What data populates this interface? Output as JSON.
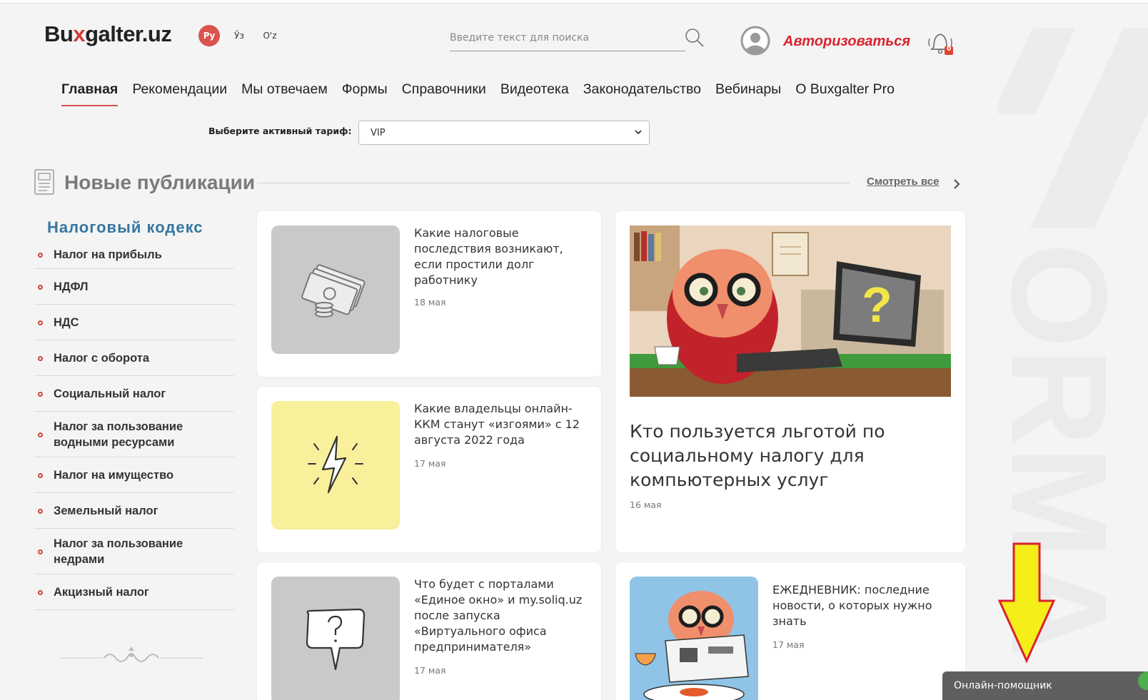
{
  "header": {
    "logo_text": "Bu",
    "logo_x": "x",
    "logo_rest": "galter.uz",
    "languages": [
      {
        "label": "Ру",
        "active": true
      },
      {
        "label": "Ўз",
        "active": false
      },
      {
        "label": "O'z",
        "active": false
      }
    ],
    "search_placeholder": "Введите текст для поиска",
    "login_label": "Авторизоваться",
    "notification_count": "0"
  },
  "nav": {
    "items": [
      {
        "label": "Главная",
        "active": true
      },
      {
        "label": "Рекомендации"
      },
      {
        "label": "Мы отвечаем"
      },
      {
        "label": "Формы"
      },
      {
        "label": "Справочники"
      },
      {
        "label": "Видеотека"
      },
      {
        "label": "Законодательство"
      },
      {
        "label": "Вебинары"
      },
      {
        "label": "О Buxgalter Pro"
      }
    ]
  },
  "tariff": {
    "label": "Выберите активный тариф:",
    "selected": "VIP"
  },
  "section": {
    "title": "Новые публикации",
    "see_all": "Смотреть все"
  },
  "sidebar": {
    "title": "Налоговый кодекс",
    "items": [
      "Налог на прибыль",
      "НДФЛ",
      "НДС",
      "Налог с оборота",
      "Социальный налог",
      "Налог за пользование водными ресурсами",
      "Налог на имущество",
      "Земельный налог",
      "Налог за пользование недрами",
      "Акцизный налог"
    ]
  },
  "articles": [
    {
      "title": "Какие налоговые последствия возникают, если простили долг работнику",
      "date": "18 мая",
      "icon": "money-icon"
    },
    {
      "title": "Какие владельцы онлайн-ККМ станут «изгоями» с 12 августа 2022 года",
      "date": "17 мая",
      "icon": "lightning-icon"
    },
    {
      "title": "Что будет с порталами «Единое окно» и my.soliq.uz после запуска «Виртуального офиса предпринимателя»",
      "date": "17 мая",
      "icon": "question-bubble-icon"
    },
    {
      "title": "ЕЖЕДНЕВНИК: последние новости, о которых нужно знать",
      "date": "17 мая",
      "icon": "owl-newspaper-image"
    }
  ],
  "featured": {
    "title": "Кто пользуется льготой по социальному налогу для компьютерных услуг",
    "date": "16 мая"
  },
  "helper": {
    "label": "Онлайн-помощник"
  },
  "colors": {
    "accent": "#d9232e",
    "sidebar_title": "#3576a0",
    "background": "#f4f4f4"
  }
}
